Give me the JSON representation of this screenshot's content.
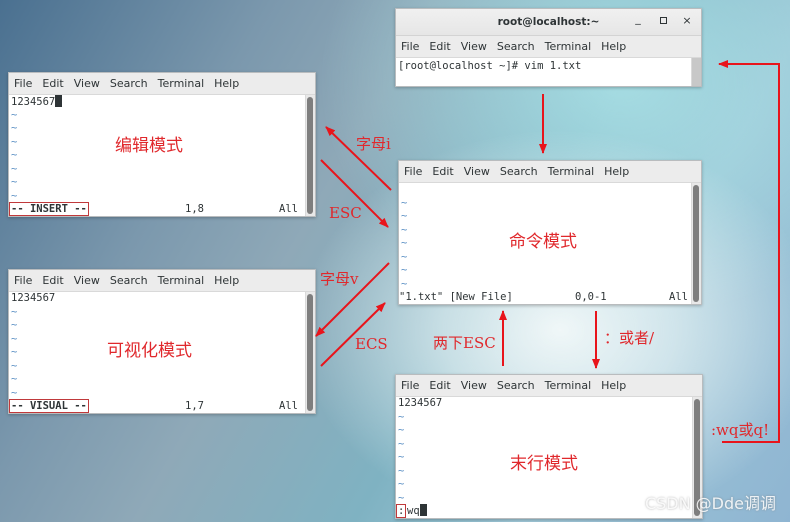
{
  "menu": [
    "File",
    "Edit",
    "View",
    "Search",
    "Terminal",
    "Help"
  ],
  "top_window": {
    "title": "root@localhost:~",
    "minimize_glyph": "_",
    "maximize_glyph": "□",
    "close_glyph": "×",
    "prompt_line": "[root@localhost ~]# vim 1.txt"
  },
  "insert_window": {
    "text_line": "1234567",
    "mode_label": "编辑模式",
    "status_mode": "-- INSERT --",
    "status_pos": "1,8",
    "status_all": "All"
  },
  "visual_window": {
    "text_line": "1234567",
    "mode_label": "可视化模式",
    "status_mode": "-- VISUAL --",
    "status_pos": "1,7",
    "status_all": "All"
  },
  "command_window": {
    "mode_label": "命令模式",
    "status_file": "\"1.txt\" [New File]",
    "status_pos": "0,0-1",
    "status_all": "All"
  },
  "lastline_window": {
    "text_line": "1234567",
    "mode_label": "末行模式",
    "command_prefix": ":",
    "command_text": "wq"
  },
  "annotations": {
    "to_insert": "字母i",
    "from_insert": "ESC",
    "to_visual": "字母v",
    "from_visual": "ECS",
    "from_lastline": "两下ESC",
    "to_lastline": "：或者/",
    "exit": ":wq或q!"
  },
  "colors": {
    "arrow": "#e8141b",
    "label": "#e0282c"
  },
  "watermark": "CSDN @Dde调调"
}
